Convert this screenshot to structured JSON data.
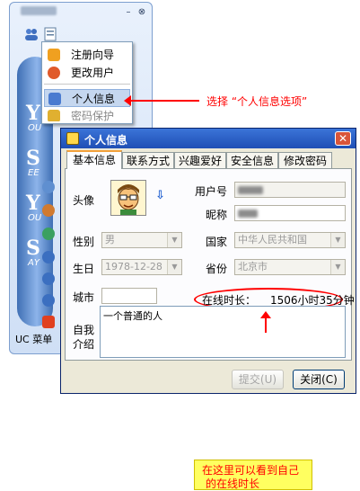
{
  "uc_window": {
    "bottom_label": "UC 菜单",
    "minimize_glyph": "–",
    "close_glyph": "⊗",
    "side_letters": [
      "Y",
      "S",
      "Y",
      "S"
    ],
    "side_small": [
      "OU",
      "EE",
      "OU",
      "AY"
    ]
  },
  "menu": {
    "items": [
      {
        "label": "注册向导",
        "icon": "wizard-icon",
        "color": "#f0a020"
      },
      {
        "label": "更改用户",
        "icon": "user-icon",
        "color": "#e05a2a"
      },
      {
        "label": "个人信息",
        "icon": "profile-icon",
        "color": "#4a7bd0"
      },
      {
        "label": "密码保护",
        "icon": "lock-icon",
        "color": "#e0b030"
      }
    ]
  },
  "annotation_top": "选择 “个人信息选项”",
  "dialog": {
    "title": "个人信息",
    "close_glyph": "✕",
    "tabs": [
      "基本信息",
      "联系方式",
      "兴趣爱好",
      "安全信息",
      "修改密码"
    ],
    "active_tab": 0,
    "avatar_label": "头像",
    "avatar_arrow": "⇩",
    "user_id_label": "用户号",
    "nickname_label": "昵称",
    "gender_label": "性别",
    "gender_value": "男",
    "country_label": "国家",
    "country_value": "中华人民共和国",
    "birthday_label": "生日",
    "birthday_value": "1978-12-28",
    "province_label": "省份",
    "province_value": "北京市",
    "city_label": "城市",
    "city_value": "",
    "online_label": "在线时长：",
    "online_value": "1506小时35分钟",
    "intro_label_1": "自我",
    "intro_label_2": "介绍",
    "intro_value": "一个普通的人",
    "annotation_line1": "在这里可以看到自己",
    "annotation_line2": "的在线时长",
    "submit_button": "提交(U)",
    "close_button": "关闭(C)",
    "dropdown_glyph": "▼",
    "accent_color": "#f3a03a",
    "annotation_color": "#ff0000"
  }
}
